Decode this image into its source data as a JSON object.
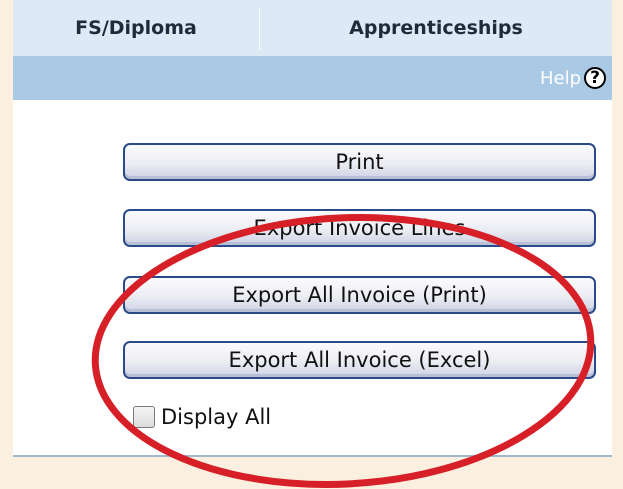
{
  "tabs": [
    {
      "label": "FS/Diploma"
    },
    {
      "label": "Apprenticeships"
    }
  ],
  "help": {
    "label": "Help",
    "icon": "question-mark-icon"
  },
  "buttons": {
    "print": "Print",
    "export_invoice_lines": "Export Invoice Lines",
    "export_all_print": "Export All Invoice (Print)",
    "export_all_excel": "Export All Invoice (Excel)"
  },
  "display_all": {
    "label": "Display All",
    "checked": false
  },
  "colors": {
    "tab_bar": "#dde9f5",
    "help_bar": "#a9c9e5",
    "button_border": "#2b4a8a",
    "annotation": "#d61f26",
    "page_background": "#fbf0df"
  }
}
